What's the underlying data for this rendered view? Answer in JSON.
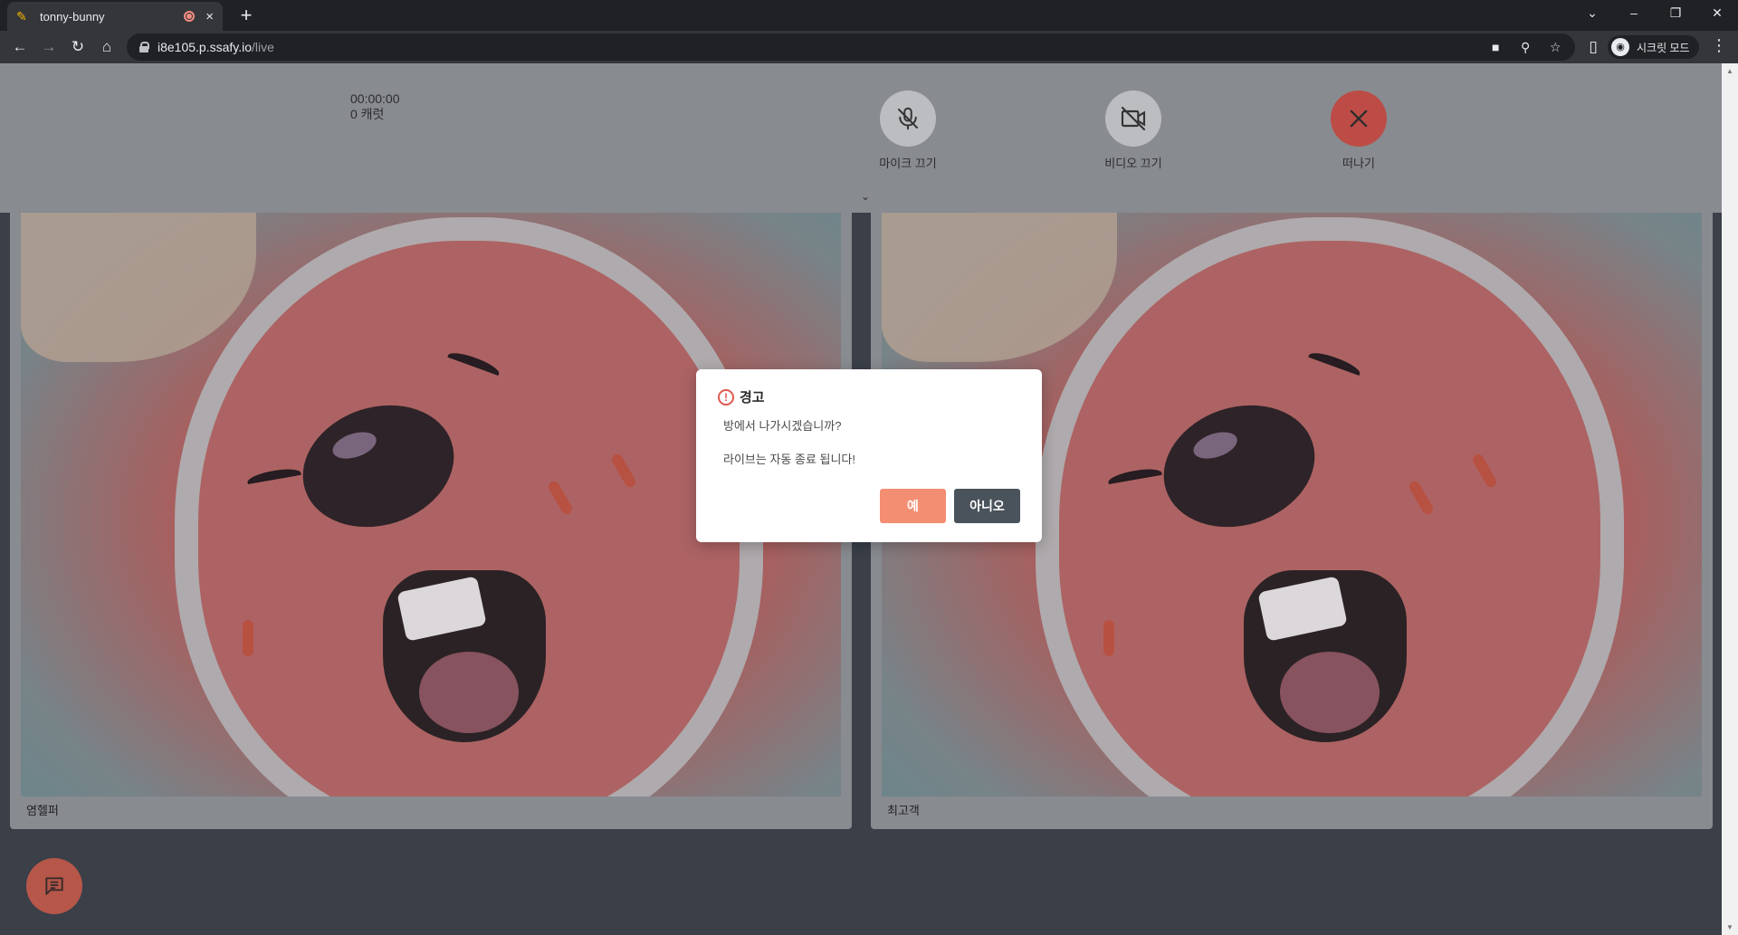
{
  "browser": {
    "tab_title": "tonny-bunny",
    "tab_close": "×",
    "new_tab": "+",
    "url_host": "i8e105.p.ssafy.io",
    "url_path": "/live",
    "incognito_label": "시크릿 모드",
    "window_controls": [
      "⌄",
      "–",
      "❐",
      "✕"
    ]
  },
  "header": {
    "timer": "00:00:00",
    "carrots": "0 캐럿",
    "mic_label": "마이크 끄기",
    "video_label": "비디오 끄기",
    "leave_label": "떠나기"
  },
  "videos": [
    {
      "name": "염헬퍼"
    },
    {
      "name": "최고객"
    }
  ],
  "modal": {
    "title": "경고",
    "line1": "방에서 나가시겠습니까?",
    "line2": "라이브는 자동 종료 됩니다!",
    "yes_label": "예",
    "no_label": "아니오"
  },
  "colors": {
    "leave": "#c84e46",
    "yes_button": "#f38e73",
    "no_button": "#4a525c",
    "chat_fab": "#c15a4a",
    "warning": "#e05a4f"
  },
  "icons": [
    "mic-off-icon",
    "video-off-icon",
    "close-icon",
    "chat-icon",
    "chevron-down-icon",
    "warning-icon"
  ]
}
